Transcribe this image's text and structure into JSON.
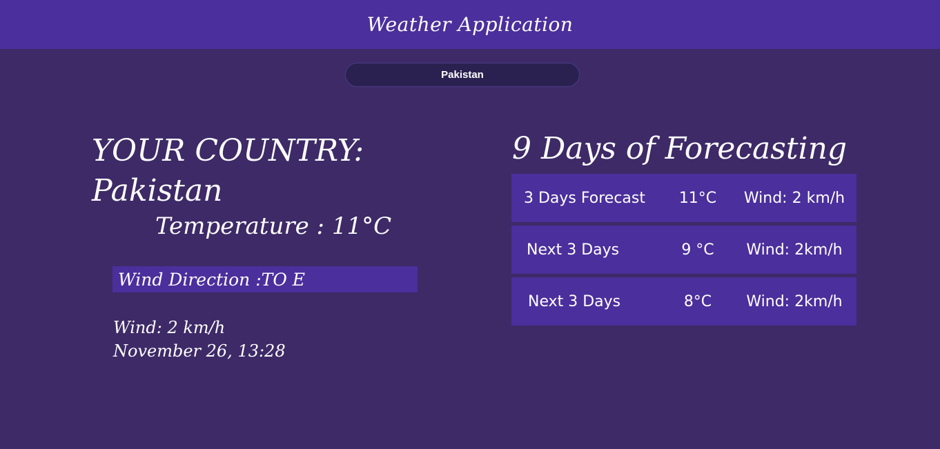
{
  "header": {
    "title": "Weather Application"
  },
  "search": {
    "value": "Pakistan"
  },
  "current": {
    "country_label": "YOUR COUNTRY:",
    "country": "Pakistan",
    "temperature": "Temperature : 11°C",
    "wind_direction": "Wind Direction :TO E",
    "wind": "Wind: 2 km/h",
    "datetime": "November 26, 13:28"
  },
  "forecast": {
    "title": "9 Days of Forecasting",
    "rows": [
      {
        "label": "3 Days Forecast",
        "temp": "11°C",
        "wind": "Wind: 2 km/h"
      },
      {
        "label": "Next 3 Days",
        "temp": "9 °C",
        "wind": "Wind: 2km/h"
      },
      {
        "label": "Next 3 Days",
        "temp": "8°C",
        "wind": "Wind: 2km/h"
      }
    ]
  },
  "colors": {
    "background": "#3d2a67",
    "header": "#4b2f9c",
    "panel": "#4b2f9c",
    "input": "#2a2150"
  }
}
